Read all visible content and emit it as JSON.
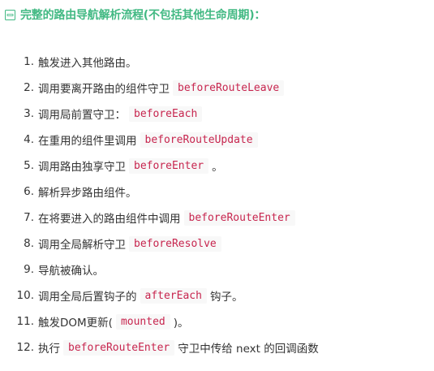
{
  "heading": {
    "text": "完整的路由导航解析流程(不包括其他生命周期)：",
    "icon": "expand-box-icon",
    "color": "#42b983"
  },
  "code_color": "#c7254e",
  "steps": [
    {
      "number": "1.",
      "parts": [
        {
          "text": "触发进入其他路由。"
        }
      ]
    },
    {
      "number": "2.",
      "parts": [
        {
          "text": "调用要离开路由的组件守卫"
        },
        {
          "code": "beforeRouteLeave"
        }
      ]
    },
    {
      "number": "3.",
      "parts": [
        {
          "text": "调用局前置守卫："
        },
        {
          "code": "beforeEach"
        }
      ]
    },
    {
      "number": "4.",
      "parts": [
        {
          "text": "在重用的组件里调用"
        },
        {
          "code": "beforeRouteUpdate"
        }
      ]
    },
    {
      "number": "5.",
      "parts": [
        {
          "text": "调用路由独享守卫"
        },
        {
          "code": "beforeEnter"
        },
        {
          "text": "。"
        }
      ]
    },
    {
      "number": "6.",
      "parts": [
        {
          "text": "解析异步路由组件。"
        }
      ]
    },
    {
      "number": "7.",
      "parts": [
        {
          "text": "在将要进入的路由组件中调用"
        },
        {
          "code": "beforeRouteEnter"
        }
      ]
    },
    {
      "number": "8.",
      "parts": [
        {
          "text": "调用全局解析守卫"
        },
        {
          "code": "beforeResolve"
        }
      ]
    },
    {
      "number": "9.",
      "parts": [
        {
          "text": "导航被确认。"
        }
      ]
    },
    {
      "number": "10.",
      "parts": [
        {
          "text": "调用全局后置钩子的"
        },
        {
          "code": "afterEach"
        },
        {
          "text": "钩子。"
        }
      ]
    },
    {
      "number": "11.",
      "parts": [
        {
          "text": "触发DOM更新("
        },
        {
          "code": "mounted"
        },
        {
          "text": ")。"
        }
      ]
    },
    {
      "number": "12.",
      "parts": [
        {
          "text": "执行"
        },
        {
          "code": "beforeRouteEnter"
        },
        {
          "text": "守卫中传给 next 的回调函数"
        }
      ]
    }
  ]
}
